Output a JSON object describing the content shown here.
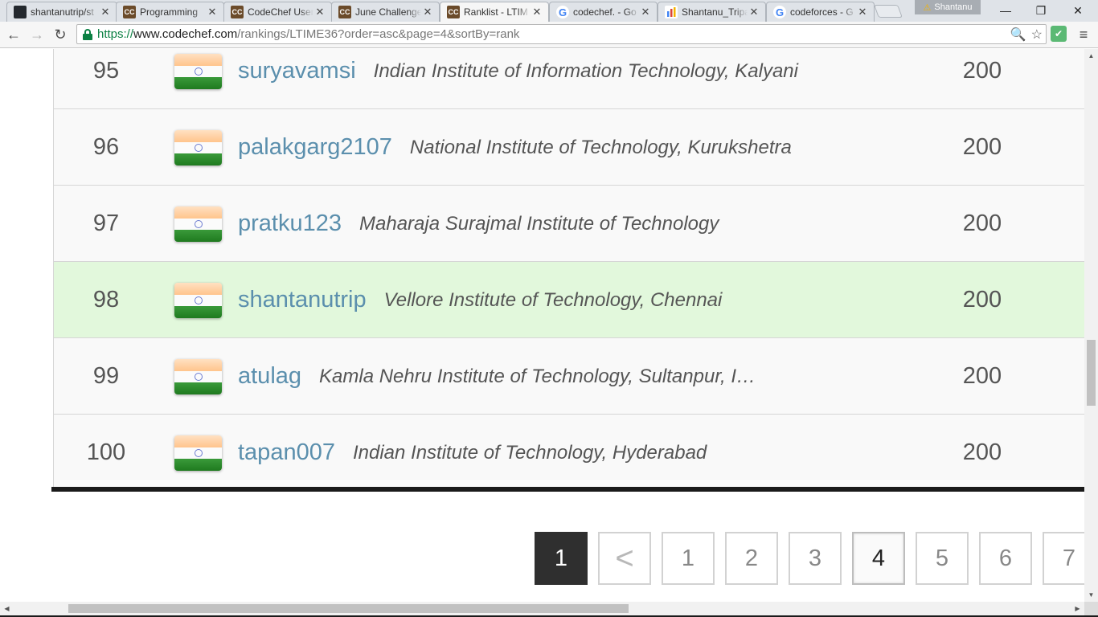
{
  "tabs": [
    {
      "title": "shantanutrip/st",
      "favicon": "github-icon"
    },
    {
      "title": "Programming",
      "favicon": "codechef-icon"
    },
    {
      "title": "CodeChef User",
      "favicon": "codechef-icon"
    },
    {
      "title": "June Challenge",
      "favicon": "codechef-icon"
    },
    {
      "title": "Ranklist - LTIM",
      "favicon": "codechef-icon",
      "active": true
    },
    {
      "title": "codechef. - Go",
      "favicon": "google-icon"
    },
    {
      "title": "Shantanu_Tripa",
      "favicon": "sheets-icon"
    },
    {
      "title": "codeforces - G",
      "favicon": "google-icon"
    }
  ],
  "favicon_text": {
    "codechef": "CC",
    "google": "G",
    "github": ""
  },
  "profile": {
    "name": "Shantanu",
    "warning_glyph": "⚠"
  },
  "window_controls": {
    "minimize": "—",
    "restore": "❐",
    "close": "✕"
  },
  "nav": {
    "back": "←",
    "forward": "→",
    "reload": "↻"
  },
  "address_bar": {
    "scheme": "https://",
    "host": "www.codechef.com",
    "path": "/rankings/LTIME36?order=asc&page=4&sortBy=rank",
    "zoom_glyph": "🔍",
    "star_glyph": "☆"
  },
  "toolbar": {
    "extension_glyph": "✔",
    "menu_glyph": "≡"
  },
  "ranklist": [
    {
      "rank": "95",
      "username": "suryavamsi",
      "institution": "Indian Institute of Information Technology, Kalyani",
      "score": "200",
      "country": "india-flag"
    },
    {
      "rank": "96",
      "username": "palakgarg2107",
      "institution": "National Institute of Technology, Kurukshetra",
      "score": "200",
      "country": "india-flag"
    },
    {
      "rank": "97",
      "username": "pratku123",
      "institution": "Maharaja Surajmal Institute of Technology",
      "score": "200",
      "country": "india-flag"
    },
    {
      "rank": "98",
      "username": "shantanutrip",
      "institution": "Vellore Institute of Technology, Chennai",
      "score": "200",
      "country": "india-flag",
      "highlighted": true
    },
    {
      "rank": "99",
      "username": "atulag",
      "institution": "Kamla Nehru Institute of Technology, Sultanpur, I…",
      "score": "200",
      "country": "india-flag"
    },
    {
      "rank": "100",
      "username": "tapan007",
      "institution": "Indian Institute of Technology, Hyderabad",
      "score": "200",
      "country": "india-flag"
    }
  ],
  "pagination": {
    "first": "1",
    "prev": "<",
    "pages": [
      "1",
      "2",
      "3",
      "4",
      "5",
      "6",
      "7"
    ],
    "current": "4"
  },
  "scrollbar": {
    "up": "▲",
    "down": "▼",
    "left": "◀",
    "right": "▶"
  },
  "colors": {
    "highlight_row": "#e2f8dc",
    "username_link": "#5b8fad",
    "secure_green": "#0b8043"
  }
}
